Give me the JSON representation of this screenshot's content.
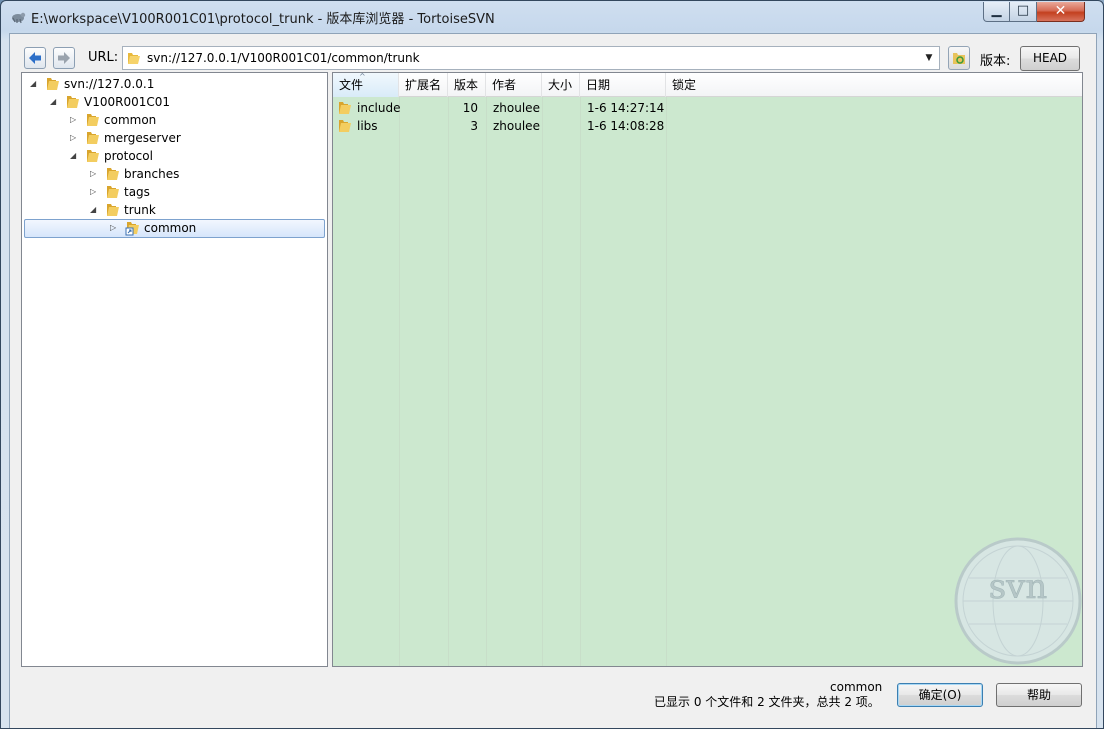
{
  "window": {
    "title": "E:\\workspace\\V100R001C01\\protocol_trunk - 版本库浏览器 - TortoiseSVN",
    "controls": [
      "minimize",
      "maximize",
      "close"
    ]
  },
  "urlbar": {
    "label": "URL:",
    "value": "svn://127.0.0.1/V100R001C01/common/trunk",
    "revision_label": "版本:",
    "revision_button": "HEAD"
  },
  "tree": {
    "nodes": [
      {
        "label": "svn://127.0.0.1",
        "level": 0,
        "expanded": true
      },
      {
        "label": "V100R001C01",
        "level": 1,
        "expanded": true
      },
      {
        "label": "common",
        "level": 2,
        "expanded": false
      },
      {
        "label": "mergeserver",
        "level": 2,
        "expanded": false
      },
      {
        "label": "protocol",
        "level": 2,
        "expanded": true
      },
      {
        "label": "branches",
        "level": 3,
        "expanded": false
      },
      {
        "label": "tags",
        "level": 3,
        "expanded": false
      },
      {
        "label": "trunk",
        "level": 3,
        "expanded": true
      },
      {
        "label": "common",
        "level": 4,
        "expanded": false,
        "selected": true,
        "external": true
      }
    ]
  },
  "list": {
    "columns": [
      "文件",
      "扩展名",
      "版本",
      "作者",
      "大小",
      "日期",
      "锁定"
    ],
    "sorted_column": "文件",
    "rows": [
      {
        "name": "include",
        "ext": "",
        "rev": "10",
        "author": "zhoulee",
        "size": "",
        "date": "1-6 14:27:14",
        "lock": ""
      },
      {
        "name": "libs",
        "ext": "",
        "rev": "3",
        "author": "zhoulee",
        "size": "",
        "date": "1-6 14:08:28",
        "lock": ""
      }
    ],
    "background": "#cce8cf",
    "watermark": "svn"
  },
  "status": {
    "selected": "common",
    "summary": "已显示 0 个文件和 2 文件夹，总共 2 项。"
  },
  "buttons": {
    "ok": "确定(O)",
    "help": "帮助"
  }
}
